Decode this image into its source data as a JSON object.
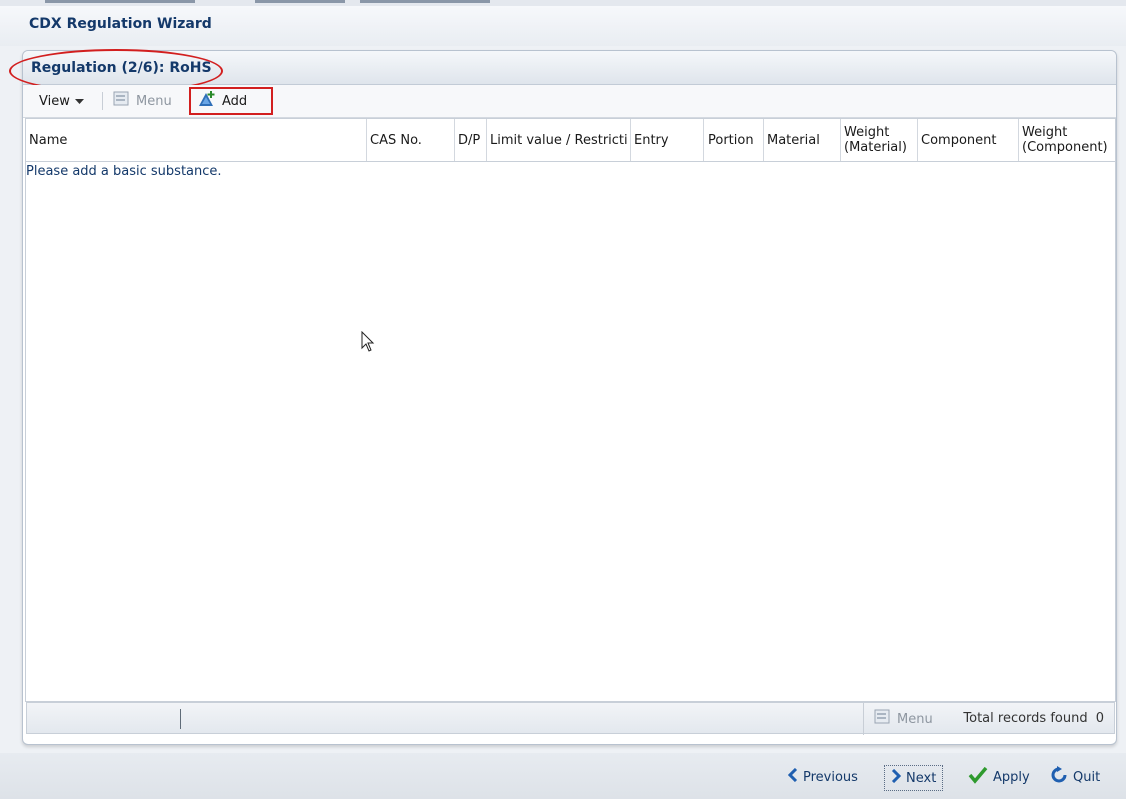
{
  "window": {
    "title": "CDX Regulation Wizard"
  },
  "panel": {
    "title": "Regulation (2/6): RoHS"
  },
  "toolbar": {
    "view_label": "View",
    "menu_label": "Menu",
    "add_label": "Add"
  },
  "table": {
    "columns": [
      "Name",
      "CAS No.",
      "D/P",
      "Limit value / Restricti",
      "Entry",
      "Portion",
      "Material",
      "Weight (Material)",
      "Component",
      "Weight (Component)"
    ],
    "empty_message": "Please add a basic substance."
  },
  "footer": {
    "menu_label": "Menu",
    "total_label": "Total records found",
    "total_count": "0"
  },
  "nav": {
    "previous_label": "Previous",
    "next_label": "Next",
    "apply_label": "Apply",
    "quit_label": "Quit"
  },
  "colors": {
    "accent": "#14396a",
    "highlight": "#d21f1f"
  },
  "icons": [
    "chevron-down-icon",
    "menu-icon",
    "add-icon",
    "previous-icon",
    "next-icon",
    "apply-icon",
    "quit-icon"
  ]
}
